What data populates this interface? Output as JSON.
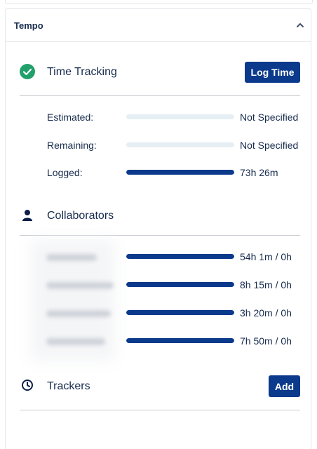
{
  "panel": {
    "title": "Tempo",
    "collapse_icon": "chevron-up-icon"
  },
  "time_tracking": {
    "title": "Time Tracking",
    "icon": "check-circle-icon",
    "icon_color": "#22a06b",
    "log_time_label": "Log Time",
    "rows": [
      {
        "label": "Estimated:",
        "value": "Not Specified",
        "fill": 0
      },
      {
        "label": "Remaining:",
        "value": "Not Specified",
        "fill": 0
      },
      {
        "label": "Logged:",
        "value": "73h 26m",
        "fill": 1
      }
    ]
  },
  "collaborators": {
    "title": "Collaborators",
    "icon": "person-icon",
    "rows": [
      {
        "value": "54h 1m / 0h",
        "fill": 1
      },
      {
        "value": "8h 15m / 0h",
        "fill": 1
      },
      {
        "value": "3h 20m / 0h",
        "fill": 1
      },
      {
        "value": "7h 50m / 0h",
        "fill": 1
      }
    ]
  },
  "trackers": {
    "title": "Trackers",
    "icon": "clock-icon",
    "add_label": "Add"
  },
  "colors": {
    "accent": "#0b3a8c",
    "bar_track": "#e6eff3",
    "text": "#172b4d"
  }
}
